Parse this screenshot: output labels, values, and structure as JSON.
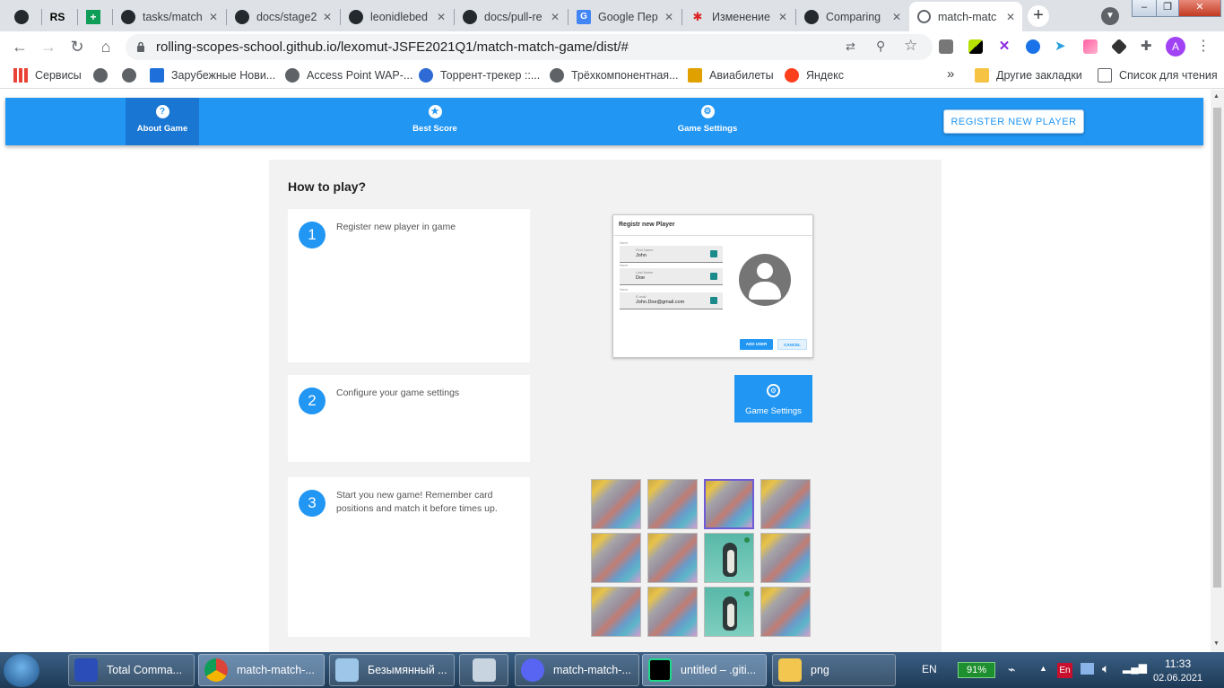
{
  "browser": {
    "tabs": [
      {
        "title": "",
        "icon": "github-icon"
      },
      {
        "title": "",
        "icon": "rs-icon"
      },
      {
        "title": "",
        "icon": "sheets-icon"
      },
      {
        "title": "tasks/match",
        "icon": "github-icon"
      },
      {
        "title": "docs/stage2",
        "icon": "github-icon"
      },
      {
        "title": "leonidlebed",
        "icon": "github-icon"
      },
      {
        "title": "docs/pull-re",
        "icon": "github-icon"
      },
      {
        "title": "Google Пер",
        "icon": "google-translate-icon"
      },
      {
        "title": "Изменение",
        "icon": "huawei-icon"
      },
      {
        "title": "Comparing",
        "icon": "github-icon"
      },
      {
        "title": "match-matc",
        "icon": "globe-icon"
      }
    ],
    "url": "rolling-scopes-school.github.io/lexomut-JSFE2021Q1/match-match-game/dist/#",
    "profile_initial": "A",
    "bookmarks": [
      {
        "label": "Сервисы",
        "icon": "apps-icon"
      },
      {
        "label": "",
        "icon": "globe-icon"
      },
      {
        "label": "",
        "icon": "globe-icon"
      },
      {
        "label": "Зарубежные Нови...",
        "icon": "ip-icon"
      },
      {
        "label": "Access Point WAP-...",
        "icon": "globe-icon"
      },
      {
        "label": "Торрент-трекер ::...",
        "icon": "torrent-icon"
      },
      {
        "label": "Трёхкомпонентная...",
        "icon": "globe-icon"
      },
      {
        "label": "Авиабилеты",
        "icon": "plane-icon"
      },
      {
        "label": "Яндекс",
        "icon": "yandex-icon"
      }
    ],
    "bookmarks_overflow": "»",
    "other_bookmarks": "Другие закладки",
    "reading_list": "Список для чтения"
  },
  "app": {
    "nav": [
      {
        "label": "About Game",
        "icon": "question-icon"
      },
      {
        "label": "Best Score",
        "icon": "star-icon"
      },
      {
        "label": "Game Settings",
        "icon": "gear-icon"
      }
    ],
    "register_button": "REGISTER NEW PLAYER",
    "heading": "How to play?",
    "steps": [
      {
        "num": "1",
        "text": "Register new player in game"
      },
      {
        "num": "2",
        "text": "Configure your game settings"
      },
      {
        "num": "3",
        "text": "Start you new game! Remember card positions and match it before times up."
      }
    ],
    "register_preview": {
      "title": "Registr new Player",
      "fields": [
        {
          "caption": "Name",
          "label": "First Name",
          "value": "John"
        },
        {
          "caption": "Name",
          "label": "Last Name",
          "value": "Doe"
        },
        {
          "caption": "Name",
          "label": "E-mail",
          "value": "John.Doe@gmail.com"
        }
      ],
      "add_button": "ADD USER",
      "cancel_button": "CANCEL"
    },
    "settings_tile": "Game Settings"
  },
  "taskbar": {
    "items": [
      {
        "label": "Total Comma..."
      },
      {
        "label": "match-match-..."
      },
      {
        "label": "Безымянный ..."
      },
      {
        "label": ""
      },
      {
        "label": "match-match-..."
      },
      {
        "label": "untitled – .giti..."
      },
      {
        "label": "png"
      }
    ],
    "lang": "EN",
    "battery": "91%",
    "kbd": "En",
    "time": "11:33",
    "date": "02.06.2021"
  }
}
